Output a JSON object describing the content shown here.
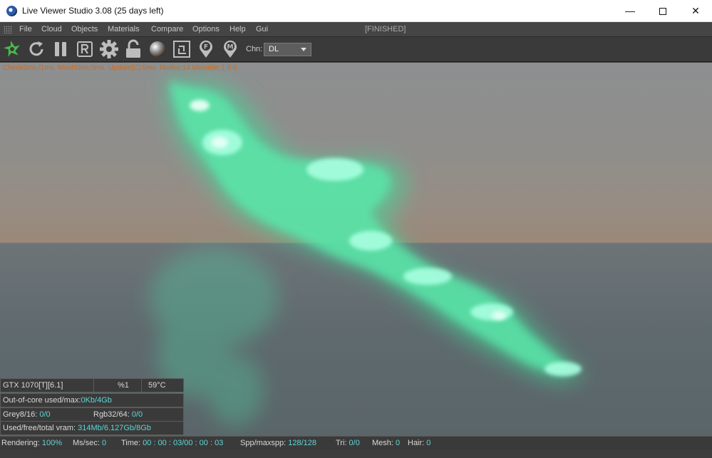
{
  "window": {
    "title": "Live Viewer Studio 3.08 (25 days left)",
    "controls": {
      "minimize": "—",
      "close": "✕"
    }
  },
  "menu": {
    "items": [
      "File",
      "Cloud",
      "Objects",
      "Materials",
      "Compare",
      "Options",
      "Help",
      "Gui"
    ],
    "render_state": "[FINISHED]"
  },
  "toolbar": {
    "buttons": [
      "render-start-icon",
      "restart-icon",
      "pause-icon",
      "region-r-icon",
      "settings-gear-icon",
      "lock-icon",
      "material-sphere-icon",
      "viewport-frame-icon",
      "focus-pin-icon",
      "material-pin-icon"
    ],
    "channel_label": "Chn:",
    "channel_value": "DL"
  },
  "viewport": {
    "debug": "Check0ms./1ms. MeshGen:0ms. Update[C]:0ms. Nodes:14 Movable:1  0 0"
  },
  "gpu_panel": {
    "gpu_name": "GTX 1070[T][6.1]",
    "gpu_percent": "%1",
    "gpu_temp": "59°C",
    "ooc_label": "Out-of-core used/max:",
    "ooc_value": "0Kb/4Gb",
    "grey_label": "Grey8/16:",
    "grey_value": "0/0",
    "rgb_label": "Rgb32/64:",
    "rgb_value": "0/0",
    "vram_label": "Used/free/total vram:",
    "vram_value": "314Mb/6.127Gb/8Gb"
  },
  "status": {
    "rendering_label": "Rendering:",
    "rendering_value": "100%",
    "ms_label": "Ms/sec:",
    "ms_value": "0",
    "time_label": "Time:",
    "time_value": "00 : 00 : 03/00 : 00 : 03",
    "spp_label": "Spp/maxspp:",
    "spp_value": "128/128",
    "tri_label": "Tri:",
    "tri_value": "0/0",
    "mesh_label": "Mesh:",
    "mesh_value": "0",
    "hair_label": "Hair:",
    "hair_value": "0"
  },
  "colors": {
    "accent_cyan": "#5fd6d6",
    "debug_orange": "#d06a1e",
    "render_green": "#4fe0a0",
    "toolbar_green": "#4cb84c"
  }
}
